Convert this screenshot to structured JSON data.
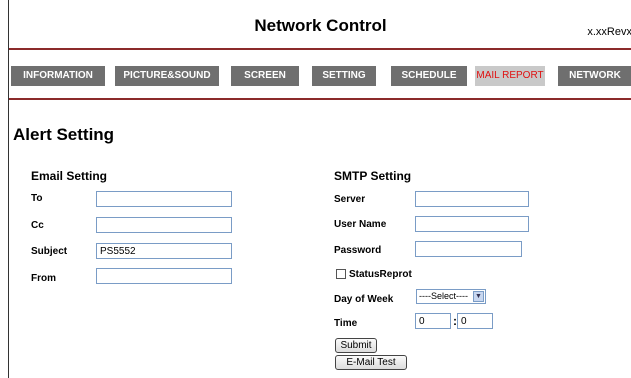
{
  "header": {
    "title": "Network Control",
    "version": "x.xxRevx"
  },
  "nav": [
    {
      "label": "INFORMATION",
      "active": false
    },
    {
      "label": "PICTURE&SOUND",
      "active": false
    },
    {
      "label": "SCREEN",
      "active": false
    },
    {
      "label": "SETTING",
      "active": false
    },
    {
      "label": "SCHEDULE",
      "active": false
    },
    {
      "label": "MAIL REPORT",
      "active": true
    },
    {
      "label": "NETWORK",
      "active": false
    }
  ],
  "page_title": "Alert Setting",
  "email": {
    "title": "Email Setting",
    "to_label": "To",
    "to_value": "",
    "cc_label": "Cc",
    "cc_value": "",
    "subject_label": "Subject",
    "subject_value": "PS5552",
    "from_label": "From",
    "from_value": ""
  },
  "smtp": {
    "title": "SMTP Setting",
    "server_label": "Server",
    "server_value": "",
    "username_label": "User Name",
    "username_value": "",
    "password_label": "Password",
    "password_value": "",
    "status_label": "StatusReprot",
    "status_checked": false,
    "dow_label": "Day of Week",
    "dow_value": "----Select----",
    "time_label": "Time",
    "time_hour": "0",
    "time_minute": "0"
  },
  "buttons": {
    "submit": "Submit",
    "test": "E-Mail Test"
  },
  "colors": {
    "nav_bg": "#6f6f6f",
    "nav_active_text": "#e01010",
    "rule": "#8b2a2a"
  }
}
